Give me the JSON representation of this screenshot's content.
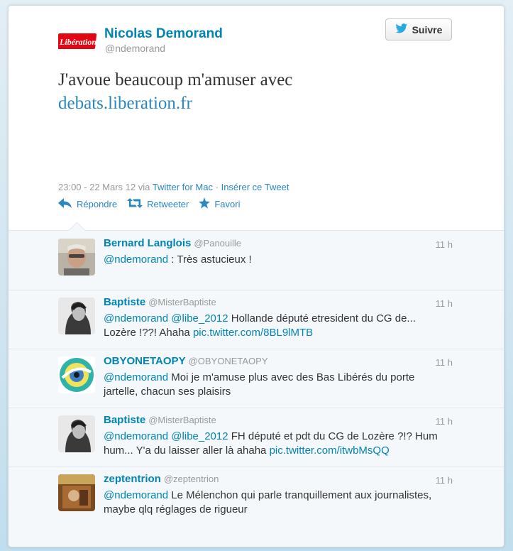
{
  "tweet": {
    "author_name": "Nicolas Demorand",
    "author_handle": "@ndemorand",
    "logo_text": "Libération",
    "follow_label": "Suivre",
    "text_line1": "J'avoue beaucoup m'amuser avec",
    "text_link": "debats.liberation.fr",
    "timestamp": "23:00 - 22 Mars 12 via",
    "client": "Twitter for Mac",
    "separator": "·",
    "embed": "Insérer ce Tweet",
    "reply_label": "Répondre",
    "retweet_label": "Retweeter",
    "favorite_label": "Favori"
  },
  "replies": [
    {
      "name": "Bernard Langlois",
      "handle": "@Panouille",
      "time": "11 h",
      "mention1": "@ndemorand",
      "text": " : Très astucieux !",
      "mention2": "",
      "text2": "",
      "link": ""
    },
    {
      "name": "Baptiste",
      "handle": "@MisterBaptiste",
      "time": "11 h",
      "mention1": "@ndemorand",
      "mention2": "@libe_2012",
      "text": " Hollande député etresident du CG de... Lozère !??! Ahaha ",
      "link": "pic.twitter.com/8BL9lMTB"
    },
    {
      "name": "OBYONETAOPY",
      "handle": "@OBYONETAOPY",
      "time": "11 h",
      "mention1": "@ndemorand",
      "mention2": "",
      "text": " Moi je m'amuse plus avec des Bas Libérés du porte jartelle, chacun ses plaisirs",
      "link": ""
    },
    {
      "name": "Baptiste",
      "handle": "@MisterBaptiste",
      "time": "11 h",
      "mention1": "@ndemorand",
      "mention2": "@libe_2012",
      "text": " FH député et pdt du CG de Lozère ?!? Hum hum... Y'a du laisser aller là ahaha ",
      "link": "pic.twitter.com/itwbMsQQ"
    },
    {
      "name": "zeptentrion",
      "handle": "@zeptentrion",
      "time": "11 h",
      "mention1": "@ndemorand",
      "mention2": "",
      "text": " Le Mélenchon qui parle tranquillement aux journalistes, maybe qlq réglages de rigueur",
      "link": ""
    }
  ],
  "colors": {
    "link": "#0084b4",
    "text": "#333333",
    "muted": "#999999",
    "bg": "#c0deed"
  }
}
